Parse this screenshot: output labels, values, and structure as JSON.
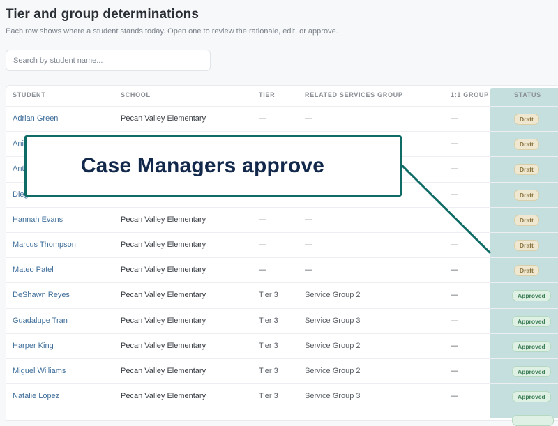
{
  "header": {
    "title": "Tier and group determinations",
    "subtitle": "Each row shows where a student stands today. Open one to review the rationale, edit, or approve."
  },
  "search": {
    "placeholder": "Search by student name..."
  },
  "table": {
    "columns": [
      "STUDENT",
      "SCHOOL",
      "TIER",
      "RELATED SERVICES GROUP",
      "1:1 GROUP",
      "STATUS"
    ],
    "rows": [
      {
        "student": "Adrian Green",
        "school": "Pecan Valley Elementary",
        "tier": "—",
        "group": "—",
        "one_to_one": "—",
        "status": "Draft"
      },
      {
        "student": "Ani",
        "school": "",
        "tier": "",
        "group": "",
        "one_to_one": "—",
        "status": "Draft"
      },
      {
        "student": "Ant",
        "school": "",
        "tier": "",
        "group": "",
        "one_to_one": "—",
        "status": "Draft"
      },
      {
        "student": "Dieg",
        "school": "",
        "tier": "",
        "group": "",
        "one_to_one": "—",
        "status": "Draft"
      },
      {
        "student": "Hannah Evans",
        "school": "Pecan Valley Elementary",
        "tier": "—",
        "group": "—",
        "one_to_one": "",
        "status": "Draft"
      },
      {
        "student": "Marcus Thompson",
        "school": "Pecan Valley Elementary",
        "tier": "—",
        "group": "—",
        "one_to_one": "—",
        "status": "Draft"
      },
      {
        "student": "Mateo Patel",
        "school": "Pecan Valley Elementary",
        "tier": "—",
        "group": "—",
        "one_to_one": "—",
        "status": "Draft"
      },
      {
        "student": "DeShawn Reyes",
        "school": "Pecan Valley Elementary",
        "tier": "Tier 3",
        "group": "Service Group 2",
        "one_to_one": "—",
        "status": "Approved"
      },
      {
        "student": "Guadalupe Tran",
        "school": "Pecan Valley Elementary",
        "tier": "Tier 3",
        "group": "Service Group 3",
        "one_to_one": "—",
        "status": "Approved"
      },
      {
        "student": "Harper King",
        "school": "Pecan Valley Elementary",
        "tier": "Tier 3",
        "group": "Service Group 2",
        "one_to_one": "—",
        "status": "Approved"
      },
      {
        "student": "Miguel Williams",
        "school": "Pecan Valley Elementary",
        "tier": "Tier 3",
        "group": "Service Group 2",
        "one_to_one": "—",
        "status": "Approved"
      },
      {
        "student": "Natalie Lopez",
        "school": "Pecan Valley Elementary",
        "tier": "Tier 3",
        "group": "Service Group 3",
        "one_to_one": "—",
        "status": "Approved"
      }
    ]
  },
  "callout": {
    "text": "Case Managers approve",
    "border_color": "#0e6b66",
    "text_color": "#13294b"
  },
  "colors": {
    "link": "#3f6e9a",
    "status_column_highlight": "#96c3c3",
    "draft_badge": "#efe7cf",
    "approved_badge": "#dff0e4"
  }
}
